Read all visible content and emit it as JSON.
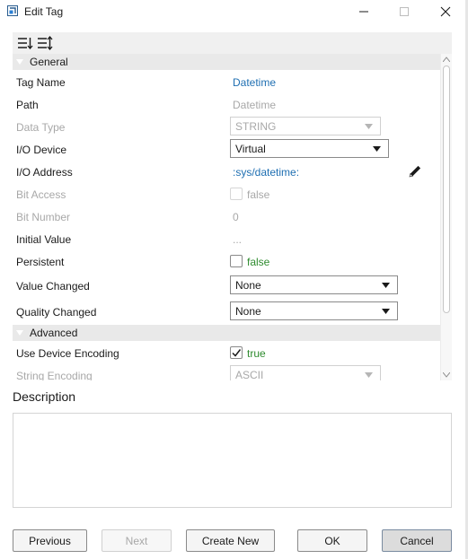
{
  "window": {
    "title": "Edit Tag"
  },
  "sections": {
    "general": "General",
    "advanced": "Advanced"
  },
  "properties": {
    "tag_name": {
      "label": "Tag Name",
      "value": "Datetime"
    },
    "path": {
      "label": "Path",
      "value": "Datetime"
    },
    "data_type": {
      "label": "Data Type",
      "value": "STRING"
    },
    "io_device": {
      "label": "I/O Device",
      "value": "Virtual"
    },
    "io_address": {
      "label": "I/O Address",
      "value": ":sys/datetime:"
    },
    "bit_access": {
      "label": "Bit Access",
      "value": "false"
    },
    "bit_number": {
      "label": "Bit Number",
      "value": "0"
    },
    "initial_value": {
      "label": "Initial Value",
      "value": "..."
    },
    "persistent": {
      "label": "Persistent",
      "value": "false"
    },
    "value_changed": {
      "label": "Value Changed",
      "value": "None"
    },
    "quality_changed": {
      "label": "Quality Changed",
      "value": "None"
    },
    "use_device_encoding": {
      "label": "Use Device Encoding",
      "value": "true"
    },
    "string_encoding": {
      "label": "String Encoding",
      "value": "ASCII"
    }
  },
  "description": {
    "label": "Description",
    "value": ""
  },
  "buttons": {
    "previous": "Previous",
    "next": "Next",
    "create_new": "Create New",
    "ok": "OK",
    "cancel": "Cancel"
  },
  "colors": {
    "link": "#1f6fb2",
    "bool": "#2e8b2e",
    "section_bg": "#e9e9e9"
  }
}
